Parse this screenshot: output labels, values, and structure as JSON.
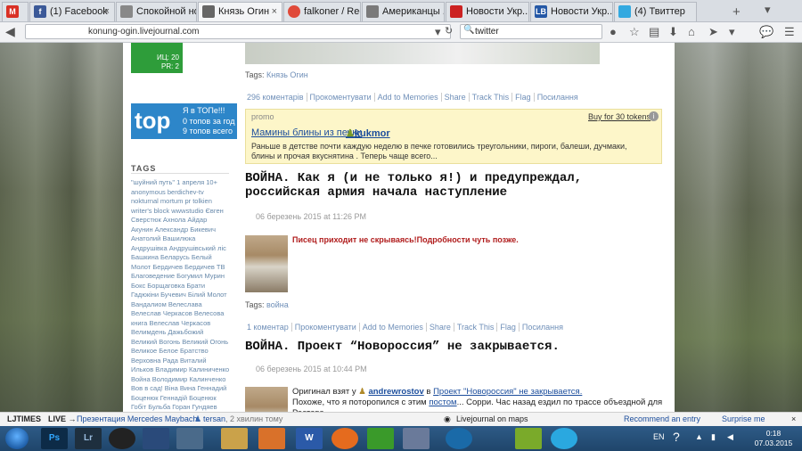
{
  "tabs": [
    {
      "label": "",
      "icon": "M",
      "color": "#d93025",
      "active": false
    },
    {
      "label": "(1) Facebook",
      "icon": "f",
      "color": "#3b5998",
      "active": false
    },
    {
      "label": "Спокойной ночи ...",
      "icon": "",
      "color": "#888",
      "active": false
    },
    {
      "label": "Князь Огин",
      "icon": "",
      "color": "#666",
      "active": true
    },
    {
      "label": "falkoner / Rec...",
      "icon": "",
      "color": "#e04a3a",
      "active": false
    },
    {
      "label": "Американцы ...",
      "icon": "",
      "color": "#7a7a7a",
      "active": false
    },
    {
      "label": "Новости Укр...",
      "icon": "",
      "color": "#c22",
      "active": false
    },
    {
      "label": "Новости Укр...",
      "icon": "LB",
      "color": "#2458a6",
      "active": false
    },
    {
      "label": "(4) Твиттер",
      "icon": "",
      "color": "#33a9e0",
      "active": false
    }
  ],
  "nav": {
    "url": "konung-ogin.livejournal.com",
    "search": "twitter"
  },
  "sidebar": {
    "badge1_l1": "ИЦ: 20",
    "badge1_l2": "PR: 2",
    "top_word": "top",
    "top_l1": "Я в ТОПе!!!",
    "top_l2": "0 топов за год",
    "top_l3": "9 топов всего",
    "tags_header": "TAGS",
    "tags": "\"шуйний путь\"  1 апреля  10+  anonymous  berdichev-tv  nokturnal mortum  pr  tolkien  writer's block  wwwstudio  Євген Сверстюк  Ахнола  Айдар  Акунин  Александр Бикевич  Анатолий Вашилюка  Андрушівка  Андрушівський ліс  Башкина  Беларусь  Белый Молот  Бердичев  Бердичев ТВ  Благоведение  Богумил Мурин  Бокс  Борщаговка  Брати Гадюкіни  Бучевич  Білий Молот  Вандалиом  Велеслава  Велеслав Черкасов  Велесова книга  Велеслав Черкасов  Велимдень Дажьбожий  Великий Вогонь  Великий Огонь  Великое Белое Братство  Верховна Рада  Виталий Ильков  Владимир Калиниченко  Война  Володимир Калинченко  Вов в сад!  Віна Вина  Геннадий Боценюк  Геннадій Боценюк  Гобіт  Бульба  Горан  Гундяев  Гурченко  Гюнтер Грасс  ДЖИДАЙДЖЕСТ  День Незалежності  Дмитро Шульц"
  },
  "post_top": {
    "tags_label": "Tags:",
    "tags_value": "Князь Огин",
    "meta": [
      "296 коментарів",
      "Прокоментувати",
      "Add to Memories",
      "Share",
      "Track This",
      "Flag",
      "Посилання"
    ]
  },
  "promo": {
    "label": "promo",
    "buy": "Buy for 30 tokens",
    "title": "Мамины блины из печки",
    "user": "kukmor",
    "text": "Раньше в детстве почти каждую неделю в печке готовились треугольники, пироги, балеши, дучмаки, блины и прочая вкуснятина . Теперь чаще всего..."
  },
  "post1": {
    "title": "ВОЙНА. Как я (и не только я!) и предупреждал, российская армия начала наступление",
    "date": "06 березень 2015 at 11:26 PM",
    "text": "Писец приходит не скрываясь!Подробности чуть позже.",
    "tags_label": "Tags:",
    "tags_value": "война",
    "meta": [
      "1 коментар",
      "Прокоментувати",
      "Add to Memories",
      "Share",
      "Track This",
      "Flag",
      "Посилання"
    ]
  },
  "post2": {
    "title": "ВОЙНА. Проект “Новороссия” не закрывается.",
    "date": "06 березень 2015 at 10:44 PM",
    "line1_pre": "Оригинал взят у",
    "line1_user": "andrewrostov",
    "line1_mid": "в",
    "line1_link": "Проект \"Новороссия\" не закрывается.",
    "line2_pre": "Похоже, что я поторопился с этим",
    "line2_link": "постом",
    "line2_post": "... Сорри. Час назад ездил по трассе объездной для Ростова"
  },
  "ticker": {
    "brand": "LJTIMES",
    "live": "LIVE →",
    "headline": "Презентация Mercedes Maybach",
    "user": "tersan",
    "ago": ", 2 хвилин тому",
    "maps": "Livejournal on maps",
    "recommend": "Recommend an entry",
    "surprise": "Surprise me"
  },
  "taskbar": {
    "lang": "EN",
    "time": "0:18",
    "date": "07.03.2015",
    "apps": [
      {
        "label": "Ps",
        "color": "#0d2b47"
      },
      {
        "label": "Lr",
        "color": "#1e2f3e"
      },
      {
        "label": "",
        "color": "#222"
      },
      {
        "label": "",
        "color": "#2a4a7a"
      },
      {
        "label": "",
        "color": "#4a6a8a"
      },
      {
        "label": "",
        "color": "#caa24a"
      },
      {
        "label": "",
        "color": "#d9712a"
      },
      {
        "label": "W",
        "color": "#2b5aa8"
      },
      {
        "label": "",
        "color": "#e56b1e"
      },
      {
        "label": "",
        "color": "#3a9a2a"
      },
      {
        "label": "",
        "color": "#6a7a9a"
      },
      {
        "label": "",
        "color": "#1a6aa8"
      },
      {
        "label": "",
        "color": "#7aaa2a"
      },
      {
        "label": "",
        "color": "#2aa8e0"
      }
    ]
  }
}
